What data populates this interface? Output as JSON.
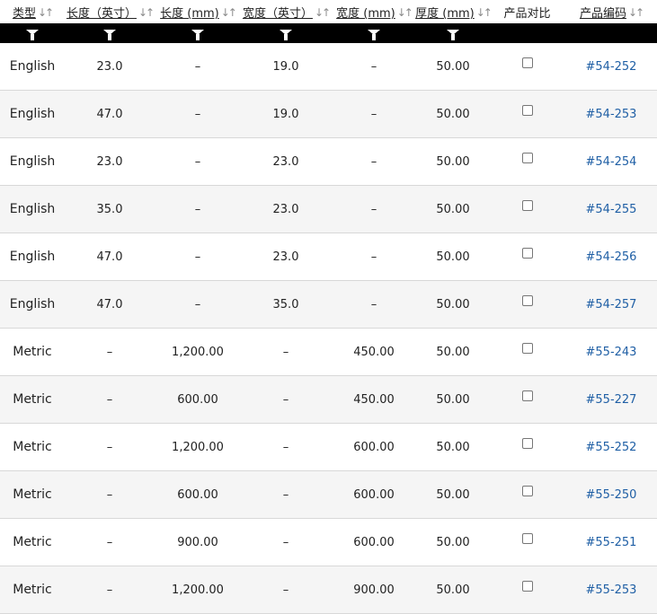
{
  "headers": [
    {
      "label": "类型",
      "sortable": true
    },
    {
      "label": "长度（英寸）",
      "sortable": true
    },
    {
      "label": "长度 (mm)",
      "sortable": true
    },
    {
      "label": "宽度（英寸）",
      "sortable": true
    },
    {
      "label": "宽度 (mm)",
      "sortable": true
    },
    {
      "label": "厚度 (mm)",
      "sortable": true
    },
    {
      "label": "产品对比",
      "sortable": false
    },
    {
      "label": "产品编码",
      "sortable": true
    }
  ],
  "sort_glyph": "↓↑",
  "filter_icon": "funnel-icon",
  "colors": {
    "filter_bar": "#000000",
    "link": "#1f5fa5",
    "alt_row": "#f5f5f5"
  },
  "rows": [
    {
      "type": "English",
      "len_in": "23.0",
      "len_mm": "–",
      "wid_in": "19.0",
      "wid_mm": "–",
      "thick": "50.00",
      "compare": false,
      "code": "#54-252"
    },
    {
      "type": "English",
      "len_in": "47.0",
      "len_mm": "–",
      "wid_in": "19.0",
      "wid_mm": "–",
      "thick": "50.00",
      "compare": false,
      "code": "#54-253"
    },
    {
      "type": "English",
      "len_in": "23.0",
      "len_mm": "–",
      "wid_in": "23.0",
      "wid_mm": "–",
      "thick": "50.00",
      "compare": false,
      "code": "#54-254"
    },
    {
      "type": "English",
      "len_in": "35.0",
      "len_mm": "–",
      "wid_in": "23.0",
      "wid_mm": "–",
      "thick": "50.00",
      "compare": false,
      "code": "#54-255"
    },
    {
      "type": "English",
      "len_in": "47.0",
      "len_mm": "–",
      "wid_in": "23.0",
      "wid_mm": "–",
      "thick": "50.00",
      "compare": false,
      "code": "#54-256"
    },
    {
      "type": "English",
      "len_in": "47.0",
      "len_mm": "–",
      "wid_in": "35.0",
      "wid_mm": "–",
      "thick": "50.00",
      "compare": false,
      "code": "#54-257"
    },
    {
      "type": "Metric",
      "len_in": "–",
      "len_mm": "1,200.00",
      "wid_in": "–",
      "wid_mm": "450.00",
      "thick": "50.00",
      "compare": false,
      "code": "#55-243"
    },
    {
      "type": "Metric",
      "len_in": "–",
      "len_mm": "600.00",
      "wid_in": "–",
      "wid_mm": "450.00",
      "thick": "50.00",
      "compare": false,
      "code": "#55-227"
    },
    {
      "type": "Metric",
      "len_in": "–",
      "len_mm": "1,200.00",
      "wid_in": "–",
      "wid_mm": "600.00",
      "thick": "50.00",
      "compare": false,
      "code": "#55-252"
    },
    {
      "type": "Metric",
      "len_in": "–",
      "len_mm": "600.00",
      "wid_in": "–",
      "wid_mm": "600.00",
      "thick": "50.00",
      "compare": false,
      "code": "#55-250"
    },
    {
      "type": "Metric",
      "len_in": "–",
      "len_mm": "900.00",
      "wid_in": "–",
      "wid_mm": "600.00",
      "thick": "50.00",
      "compare": false,
      "code": "#55-251"
    },
    {
      "type": "Metric",
      "len_in": "–",
      "len_mm": "1,200.00",
      "wid_in": "–",
      "wid_mm": "900.00",
      "thick": "50.00",
      "compare": false,
      "code": "#55-253"
    }
  ]
}
